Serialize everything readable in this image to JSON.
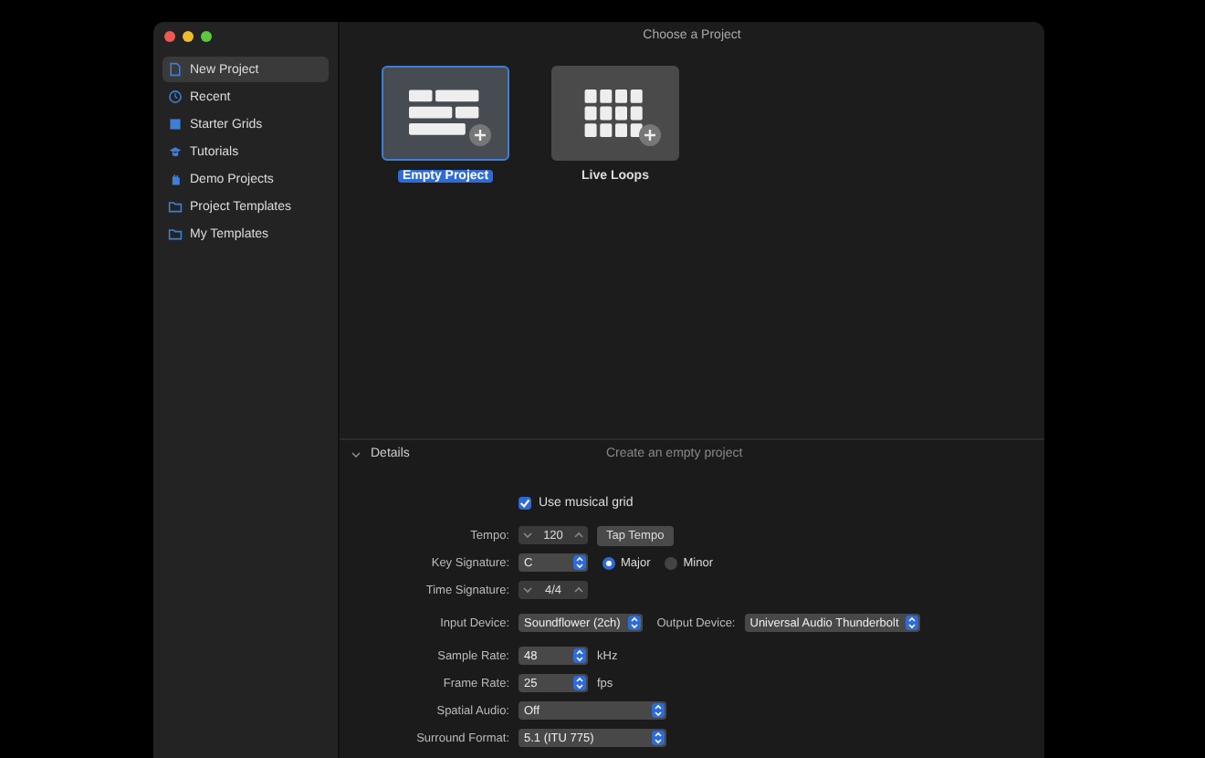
{
  "window": {
    "title": "Choose a Project"
  },
  "sidebar": {
    "items": [
      {
        "label": "New Project",
        "selected": true
      },
      {
        "label": "Recent",
        "selected": false
      },
      {
        "label": "Starter Grids",
        "selected": false
      },
      {
        "label": "Tutorials",
        "selected": false
      },
      {
        "label": "Demo Projects",
        "selected": false
      },
      {
        "label": "Project Templates",
        "selected": false
      },
      {
        "label": "My Templates",
        "selected": false
      }
    ]
  },
  "templates": [
    {
      "label": "Empty Project",
      "kind": "blocks",
      "selected": true
    },
    {
      "label": "Live Loops",
      "kind": "grid",
      "selected": false
    }
  ],
  "details": {
    "label": "Details",
    "expanded": true,
    "description": "Create an empty project",
    "use_musical_grid": {
      "label": "Use musical grid",
      "checked": true
    },
    "groups": [
      [
        {
          "label": "Tempo:",
          "controls": [
            {
              "kind": "stepper",
              "value": "120"
            },
            {
              "kind": "button",
              "label": "Tap Tempo"
            }
          ]
        },
        {
          "label": "Key Signature:",
          "controls": [
            {
              "kind": "select",
              "value": "C"
            },
            {
              "kind": "radio",
              "label": "Major",
              "selected": true
            },
            {
              "kind": "radio",
              "label": "Minor",
              "selected": false
            }
          ]
        },
        {
          "label": "Time Signature:",
          "controls": [
            {
              "kind": "stepper",
              "value": "4/4"
            }
          ]
        }
      ],
      [
        {
          "label": "Input Device:",
          "controls": [
            {
              "kind": "select",
              "value": "Soundflower (2ch)"
            },
            {
              "kind": "label",
              "label": "Output Device:"
            },
            {
              "kind": "select",
              "value": "Universal Audio Thunderbolt"
            }
          ]
        }
      ],
      [
        {
          "label": "Sample Rate:",
          "controls": [
            {
              "kind": "select",
              "value": "48"
            },
            {
              "kind": "unit",
              "label": "kHz"
            }
          ]
        },
        {
          "label": "Frame Rate:",
          "controls": [
            {
              "kind": "select",
              "value": "25"
            },
            {
              "kind": "unit",
              "label": "fps"
            }
          ]
        },
        {
          "label": "Spatial Audio:",
          "controls": [
            {
              "kind": "select",
              "value": "Off"
            }
          ]
        },
        {
          "label": "Surround Format:",
          "controls": [
            {
              "kind": "select",
              "value": "5.1 (ITU 775)"
            }
          ]
        }
      ]
    ]
  }
}
